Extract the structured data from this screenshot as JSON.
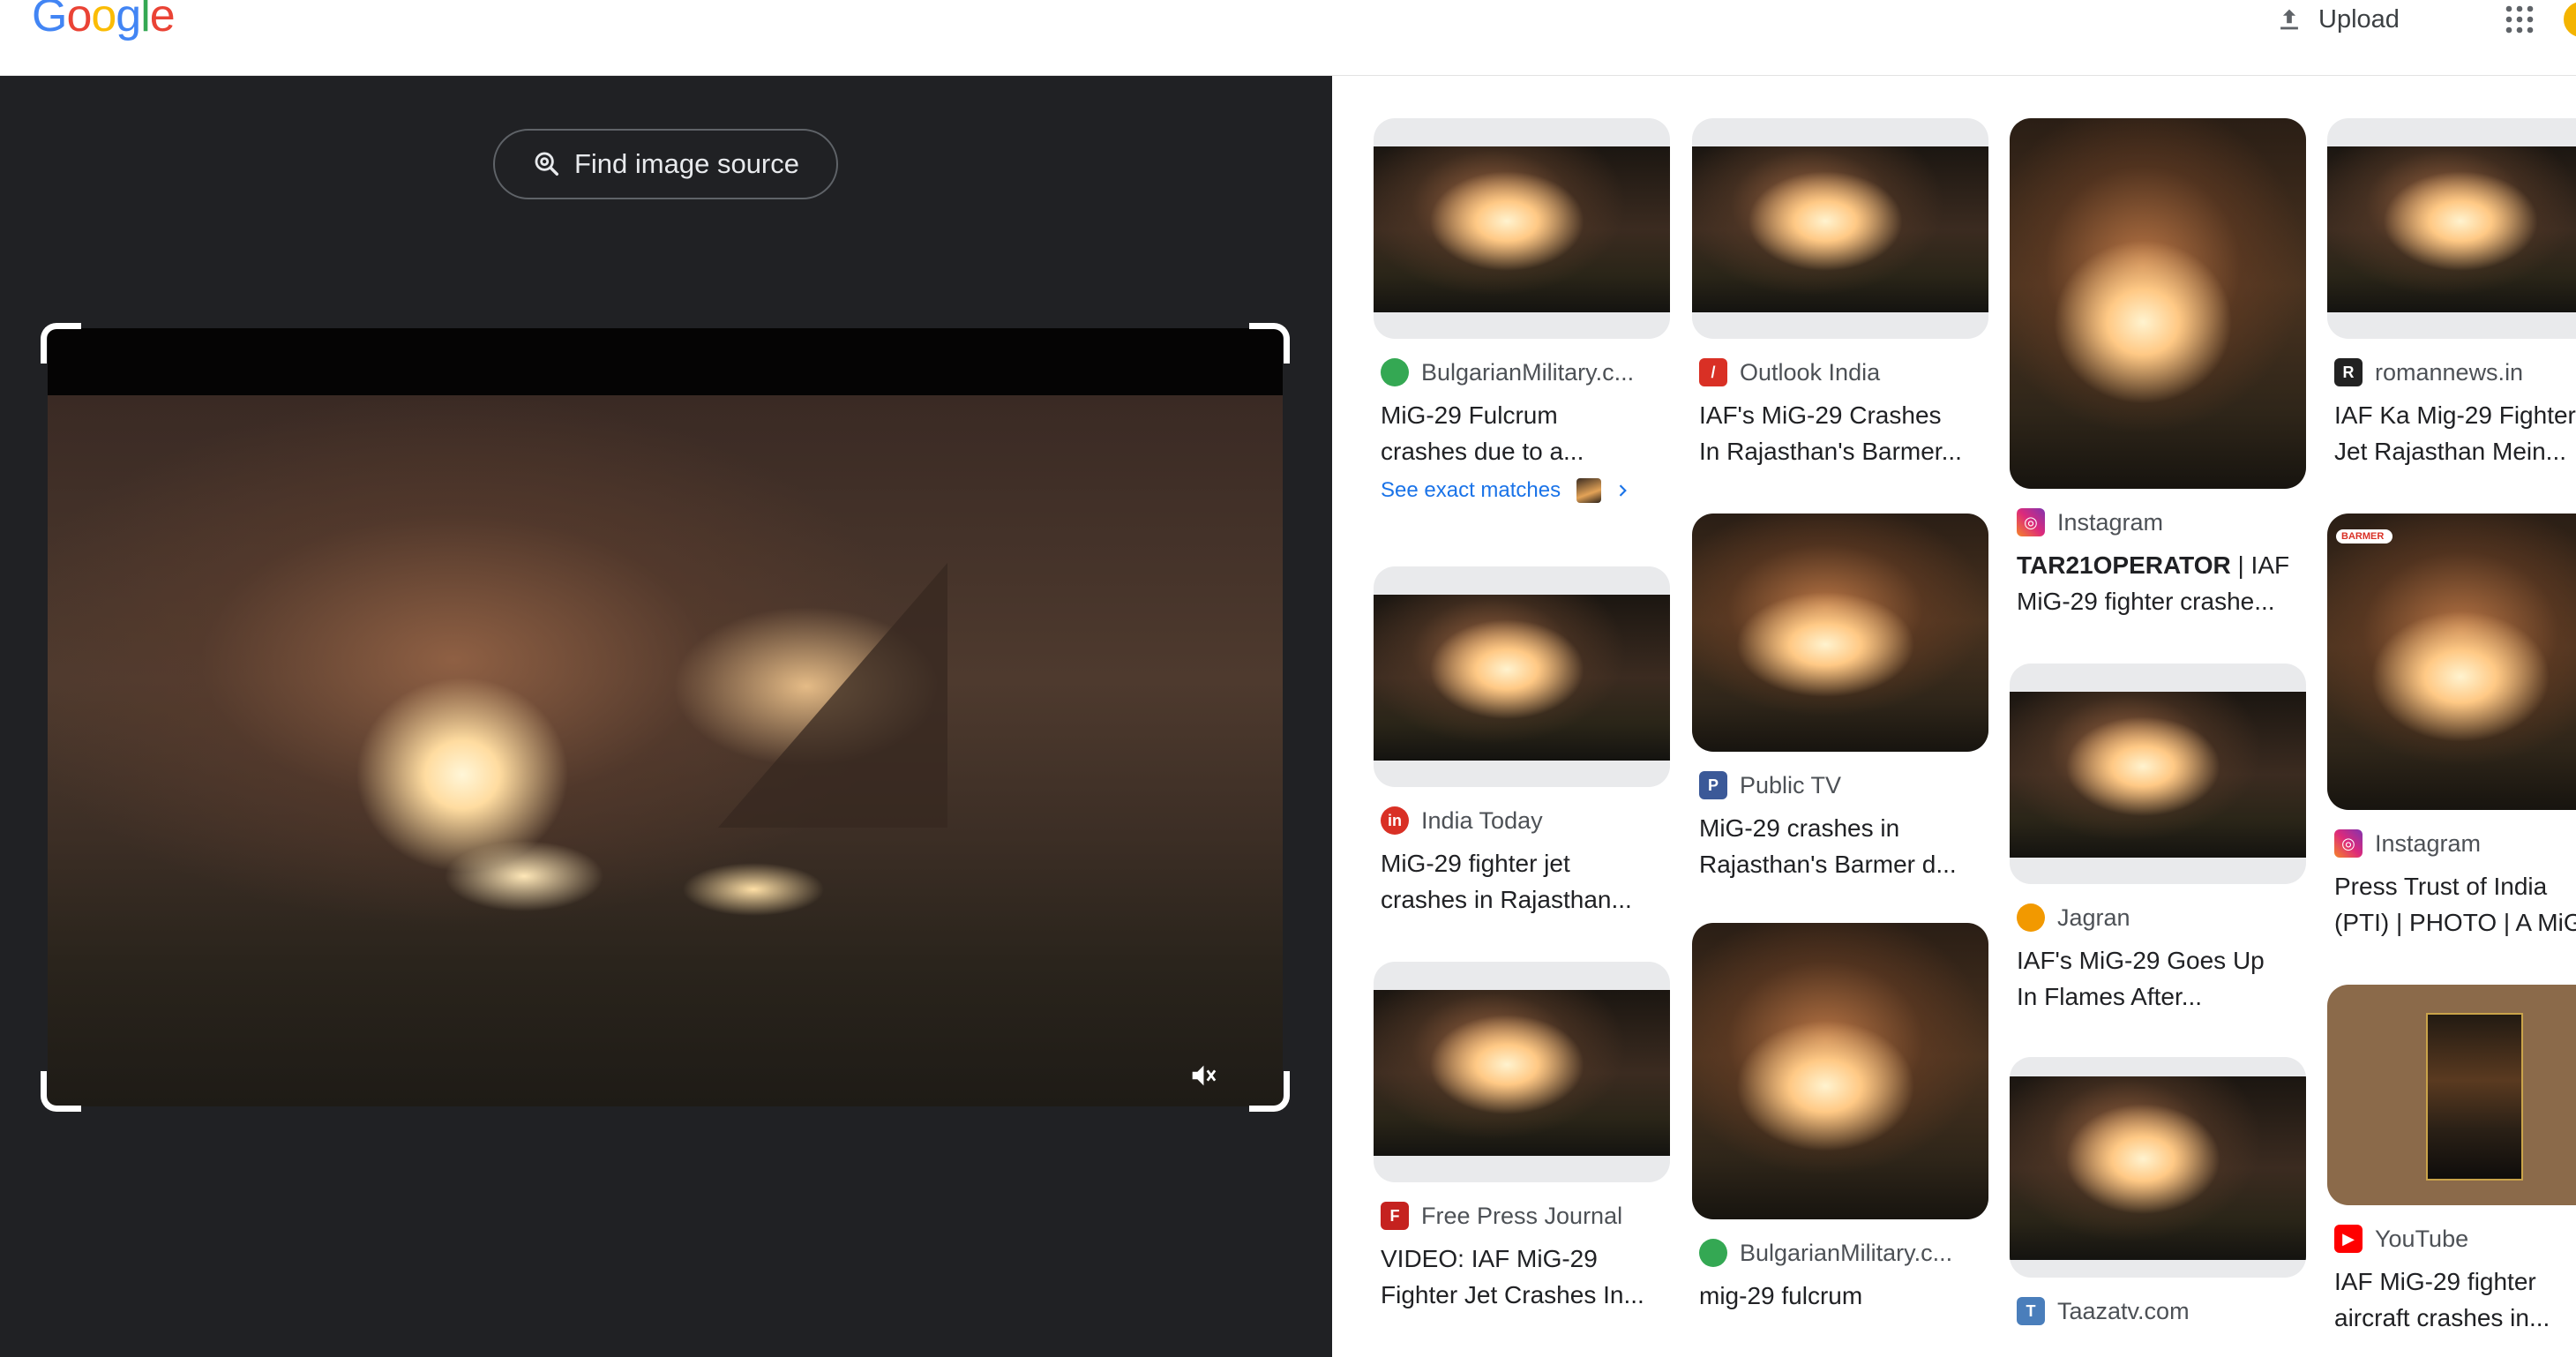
{
  "header": {
    "logo_letters": [
      {
        "ch": "G",
        "color": "#4285F4"
      },
      {
        "ch": "o",
        "color": "#EA4335"
      },
      {
        "ch": "o",
        "color": "#FBBC05"
      },
      {
        "ch": "g",
        "color": "#4285F4"
      },
      {
        "ch": "l",
        "color": "#34A853"
      },
      {
        "ch": "e",
        "color": "#EA4335"
      }
    ],
    "upload_label": "Upload",
    "icons": [
      "upload-icon",
      "apps-grid-icon",
      "account-avatar"
    ]
  },
  "viewer": {
    "find_source_label": "Find image source",
    "icons": [
      "lens-search-icon",
      "mute-icon"
    ]
  },
  "results": [
    {
      "source": "BulgarianMilitary.c...",
      "title": "MiG-29 Fulcrum\ncrashes due to a...",
      "fav_color": "#34a853",
      "exact_label": "See exact matches"
    },
    {
      "source": "India Today",
      "title": "MiG-29 fighter jet\ncrashes in Rajasthan...",
      "fav_color": "#d93025"
    },
    {
      "source": "Free Press Journal",
      "title": "VIDEO: IAF MiG-29\nFighter Jet Crashes In...",
      "fav_color": "#c5221f"
    },
    {
      "source": "Outlook India",
      "title": "IAF's MiG-29 Crashes\nIn Rajasthan's Barmer...",
      "fav_color": "#d93025"
    },
    {
      "source": "Public TV",
      "title": "MiG-29 crashes in\nRajasthan's Barmer d...",
      "fav_color": "#3b5998"
    },
    {
      "source": "BulgarianMilitary.c...",
      "title": "mig-29 fulcrum",
      "fav_color": "#34a853"
    },
    {
      "source": "Instagram",
      "title_bold": "TAR21OPERATOR",
      "title": " | IAF\nMiG-29 fighter crashe...",
      "fav_color": "#c13584"
    },
    {
      "source": "Jagran",
      "title": "IAF's MiG-29 Goes Up\nIn Flames After...",
      "fav_color": "#f29900"
    },
    {
      "source": "Taazatv.com",
      "title": "",
      "fav_color": "#4a7ebb"
    },
    {
      "source": "romannews.in",
      "title": "IAF Ka Mig-29 Fighter\nJet Rajasthan Mein...",
      "fav_color": "#222222"
    },
    {
      "source": "Instagram",
      "title": "Press Trust of India\n(PTI) | PHOTO | A MiG",
      "fav_color": "#c13584",
      "badge": "BARMER"
    },
    {
      "source": "YouTube",
      "title": "IAF MiG-29 fighter\naircraft crashes in...",
      "fav_color": "#ff0000"
    }
  ]
}
